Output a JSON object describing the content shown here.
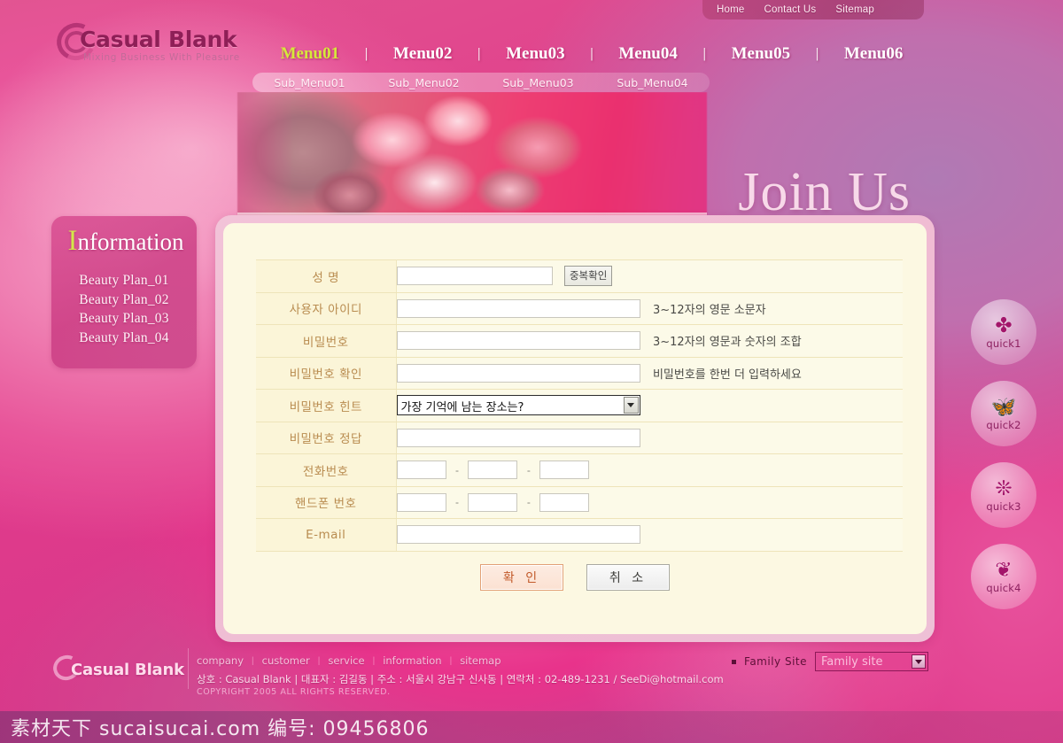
{
  "topbar": {
    "links": [
      {
        "label": "Home",
        "name": "home"
      },
      {
        "label": "Contact Us",
        "name": "contact-us"
      },
      {
        "label": "Sitemap",
        "name": "sitemap"
      }
    ]
  },
  "brand": {
    "name": "Casual Blank",
    "tagline": "Mixing Business With Pleasure"
  },
  "nav": {
    "items": [
      {
        "label": "Menu01",
        "active": true
      },
      {
        "label": "Menu02",
        "active": false
      },
      {
        "label": "Menu03",
        "active": false
      },
      {
        "label": "Menu04",
        "active": false
      },
      {
        "label": "Menu05",
        "active": false
      },
      {
        "label": "Menu06",
        "active": false
      }
    ],
    "separator": "|",
    "active_color": "#d6e83a"
  },
  "subnav": {
    "items": [
      {
        "label": "Sub_Menu01"
      },
      {
        "label": "Sub_Menu02"
      },
      {
        "label": "Sub_Menu03"
      },
      {
        "label": "Sub_Menu04"
      }
    ]
  },
  "banner": {
    "title": "Join Us"
  },
  "information": {
    "title_cap": "I",
    "title_rest": "nformation",
    "items": [
      {
        "label": "Beauty Plan_01"
      },
      {
        "label": "Beauty Plan_02"
      },
      {
        "label": "Beauty Plan_03"
      },
      {
        "label": "Beauty Plan_04"
      }
    ]
  },
  "form": {
    "rows": [
      {
        "label": "성 명",
        "type": "text_button",
        "value": "",
        "button_label": "중복확인",
        "hint": ""
      },
      {
        "label": "사용자 아이디",
        "type": "text_hint",
        "value": "",
        "hint": "3~12자의 영문 소문자"
      },
      {
        "label": "비밀번호",
        "type": "text_hint",
        "value": "",
        "hint": "3~12자의 영문과 숫자의 조합"
      },
      {
        "label": "비밀번호 확인",
        "type": "text_hint",
        "value": "",
        "hint": "비밀번호를 한번 더 입력하세요"
      },
      {
        "label": "비밀번호 힌트",
        "type": "select",
        "value": "가장 기억에 남는 장소는?",
        "hint": ""
      },
      {
        "label": "비밀번호 정답",
        "type": "text_wide",
        "value": "",
        "hint": ""
      },
      {
        "label": "전화번호",
        "type": "three_part",
        "parts": [
          "",
          "",
          ""
        ],
        "separator": "-"
      },
      {
        "label": "핸드폰 번호",
        "type": "three_part",
        "parts": [
          "",
          "",
          ""
        ],
        "separator": "-"
      },
      {
        "label": "E-mail",
        "type": "text_wide",
        "value": "",
        "hint": ""
      }
    ],
    "submit_label": "확 인",
    "cancel_label": "취 소"
  },
  "quickmenu": {
    "items": [
      {
        "label": "quick1",
        "icon": "clover-icon",
        "glyph": "✤"
      },
      {
        "label": "quick2",
        "icon": "butterfly-icon",
        "glyph": "🦋"
      },
      {
        "label": "quick3",
        "icon": "snowflake-icon",
        "glyph": "❊"
      },
      {
        "label": "quick4",
        "icon": "leaves-icon",
        "glyph": "❦"
      }
    ]
  },
  "footer": {
    "brand": "Casual Blank",
    "links": [
      {
        "label": "company"
      },
      {
        "label": "customer"
      },
      {
        "label": "service"
      },
      {
        "label": "information"
      },
      {
        "label": "sitemap"
      }
    ],
    "separator": "|",
    "company_line": "상호 : Casual Blank  | 대표자 : 김길동 | 주소 : 서울시 강남구 신사동 | 연락처 : 02-489-1231 / SeeDi@hotmail.com",
    "copyright": "COPYRIGHT  2005    ALL RIGHTS RESERVED.",
    "family_site_label": "Family Site",
    "family_site_value": "Family site"
  },
  "watermark": {
    "text": "素材天下 sucaisucai.com 编号: 09456806"
  }
}
